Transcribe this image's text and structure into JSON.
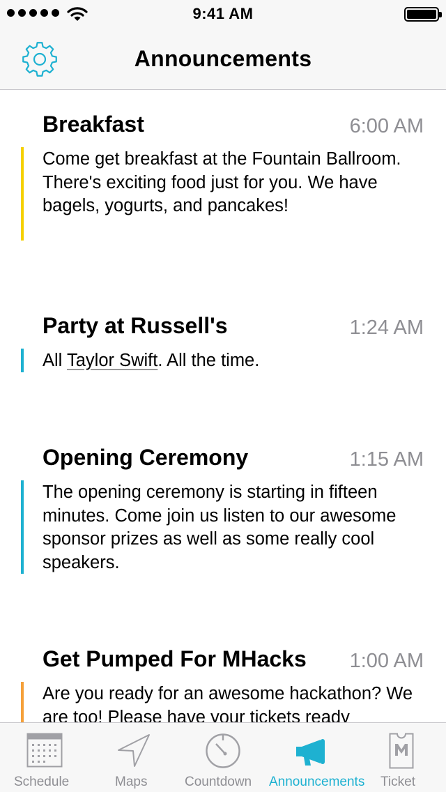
{
  "status_bar": {
    "time": "9:41 AM"
  },
  "nav": {
    "title": "Announcements",
    "settings_icon": "gear-icon"
  },
  "colors": {
    "accent": "#1eb1d1",
    "yellow": "#f5d000",
    "orange": "#f5a03a",
    "time_gray": "#8e8e93"
  },
  "announcements": [
    {
      "title": "Breakfast",
      "time": "6:00 AM",
      "body": "Come get breakfast at the Fountain Ballroom. There's exciting food just for you. We have bagels, yogurts, and pancakes!"
    },
    {
      "title": "Party at Russell's",
      "time": "1:24 AM",
      "body_prefix": "All ",
      "body_link": "Taylor Swift",
      "body_suffix": ". All the time."
    },
    {
      "title": "Opening Ceremony",
      "time": "1:15 AM",
      "body": "The opening ceremony is starting in fifteen minutes. Come join us listen to our awesome sponsor prizes as well as some really cool speakers."
    },
    {
      "title": "Get Pumped For MHacks",
      "time": "1:00 AM",
      "body": "Are you ready for an awesome hackathon? We are too! Please have your tickets ready"
    }
  ],
  "tabs": [
    {
      "label": "Schedule",
      "icon": "calendar-icon"
    },
    {
      "label": "Maps",
      "icon": "navigation-arrow-icon"
    },
    {
      "label": "Countdown",
      "icon": "timer-icon"
    },
    {
      "label": "Announcements",
      "icon": "megaphone-icon",
      "selected": true
    },
    {
      "label": "Ticket",
      "icon": "ticket-icon"
    }
  ]
}
